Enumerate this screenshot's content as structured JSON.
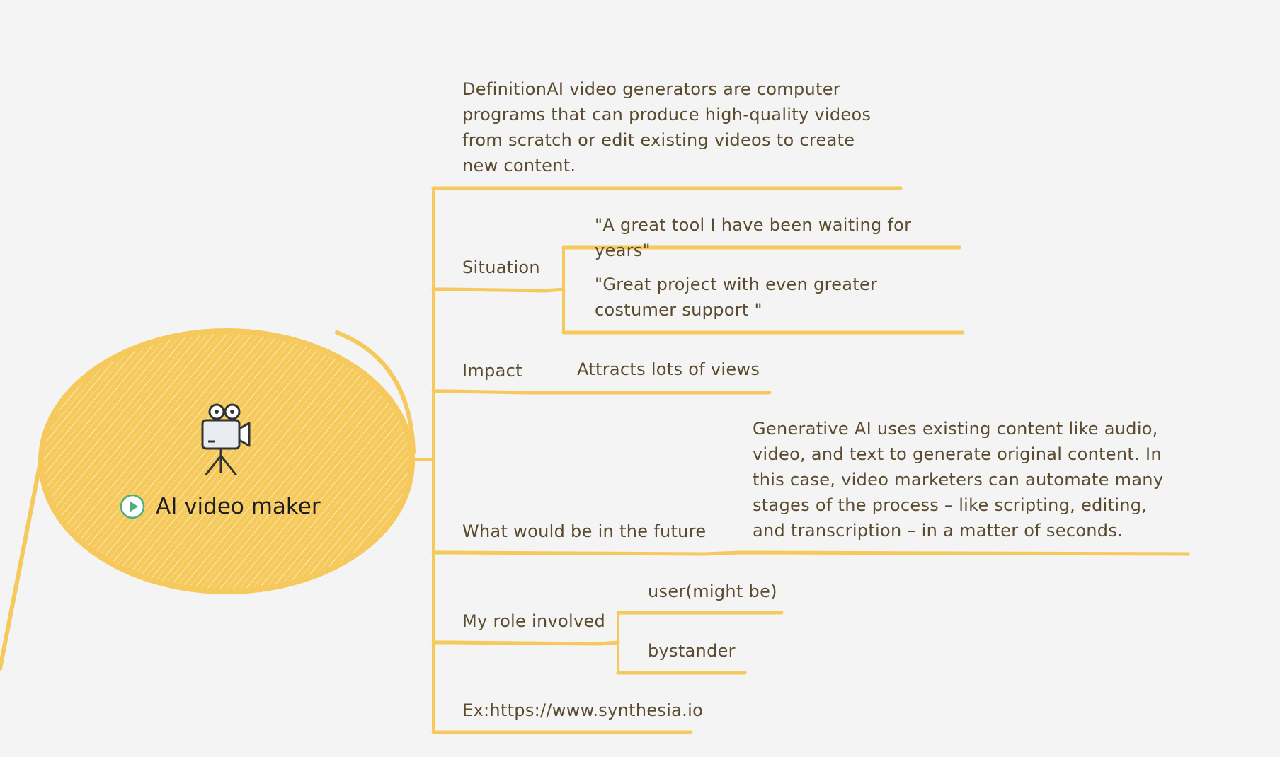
{
  "colors": {
    "background": "#f4f4f4",
    "branch": "#f5c95b",
    "central_fill": "#f5c95b",
    "text": "#5a4a2e",
    "play_accent": "#4caf7d"
  },
  "central": {
    "icon": "movie-camera-icon",
    "play_icon": "play-circle-icon",
    "title": "AI video maker"
  },
  "branches": [
    {
      "label": "DefinitionAI video generators are computer programs that can produce high-quality videos from scratch or edit existing videos to create new content.",
      "children": []
    },
    {
      "label": "Situation",
      "children": [
        "\"A great tool I have been waiting for years\"",
        "\"Great project with even greater costumer support \""
      ]
    },
    {
      "label": "Impact",
      "children": [
        "Attracts lots of views"
      ]
    },
    {
      "label": "What would be in the future",
      "children": [
        "Generative AI uses existing content like audio, video, and text to generate original content. In this case, video marketers can automate many stages of the process – like scripting, editing, and transcription – in a matter of seconds."
      ]
    },
    {
      "label": "My role involved",
      "children": [
        "user(might be)",
        "bystander"
      ]
    },
    {
      "label": "Ex:https://www.synthesia.io",
      "children": []
    }
  ]
}
